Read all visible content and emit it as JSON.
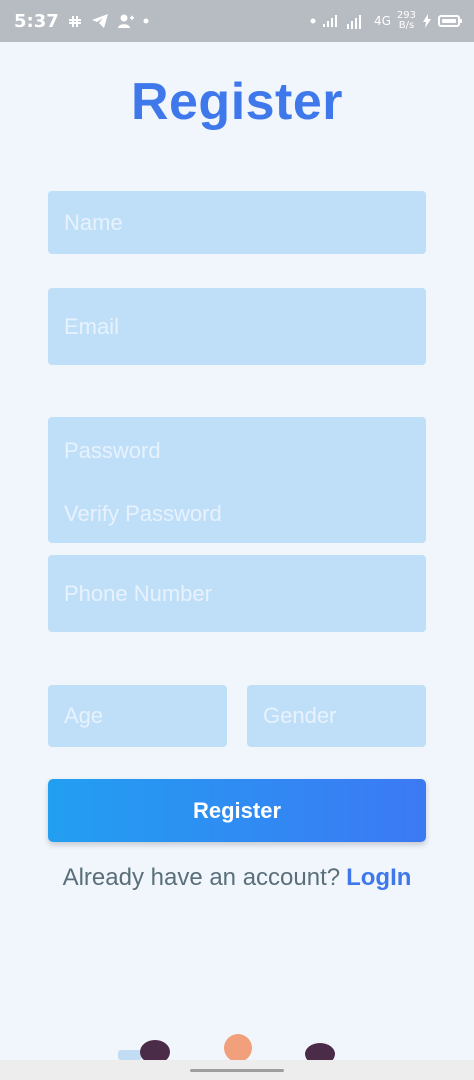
{
  "status_bar": {
    "time": "5:37",
    "network_type": "4G",
    "speed_value": "293",
    "speed_unit": "B/s"
  },
  "page": {
    "title": "Register"
  },
  "form": {
    "name_placeholder": "Name",
    "email_placeholder": "Email",
    "password_placeholder": "Password",
    "verify_password_placeholder": "Verify Password",
    "phone_placeholder": "Phone Number",
    "age_placeholder": "Age",
    "gender_placeholder": "Gender",
    "register_label": "Register"
  },
  "footer": {
    "prompt": "Already have an account?",
    "login_label": "LogIn"
  },
  "icons": {
    "status": [
      "slack-icon",
      "telegram-icon",
      "add-user-icon",
      "dot-icon"
    ],
    "status_right": [
      "dot-icon",
      "signal-icon",
      "signal-4g-icon",
      "charging-icon",
      "battery-icon"
    ]
  },
  "colors": {
    "accent": "#3f78ea",
    "field_bg": "#bfdff8",
    "button_gradient_start": "#229ff1",
    "button_gradient_end": "#3c79f4",
    "background": "#f1f6fd",
    "status_bar": "#b7bbc2"
  }
}
